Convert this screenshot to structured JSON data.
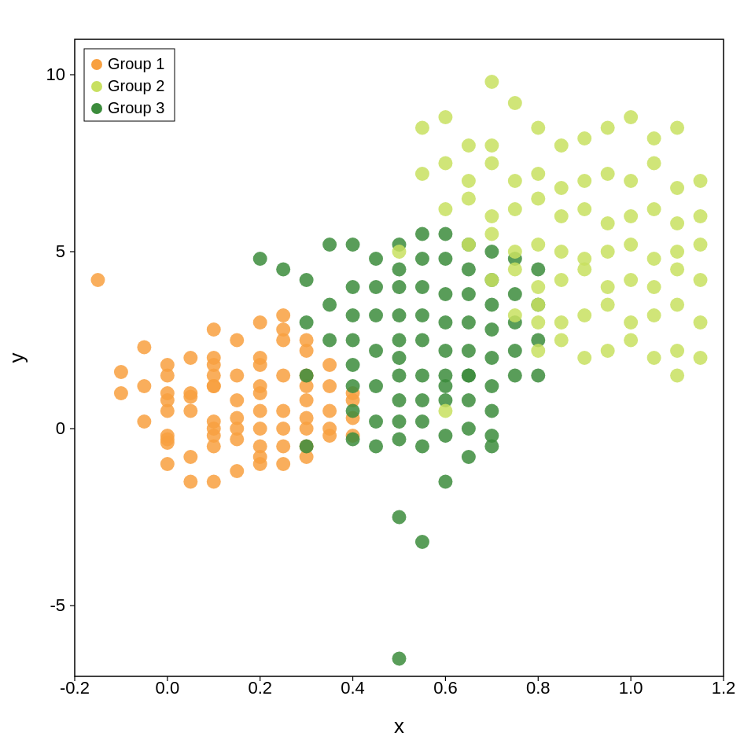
{
  "chart": {
    "title": "",
    "x_label": "x",
    "y_label": "y",
    "x_min": -0.2,
    "x_max": 1.2,
    "y_min": -7,
    "y_max": 11,
    "x_ticks": [
      -0.2,
      0.0,
      0.2,
      0.4,
      0.6,
      0.8,
      1.0,
      1.2
    ],
    "y_ticks": [
      -5,
      0,
      5,
      10
    ],
    "legend": [
      {
        "label": "Group 1",
        "color": "#F8A040"
      },
      {
        "label": "Group 2",
        "color": "#C8E060"
      },
      {
        "label": "Group 3",
        "color": "#3C8C3C"
      }
    ],
    "groups": {
      "group1_color": "#F8A040",
      "group2_color": "#C8E060",
      "group3_color": "#3C8C3C"
    }
  }
}
